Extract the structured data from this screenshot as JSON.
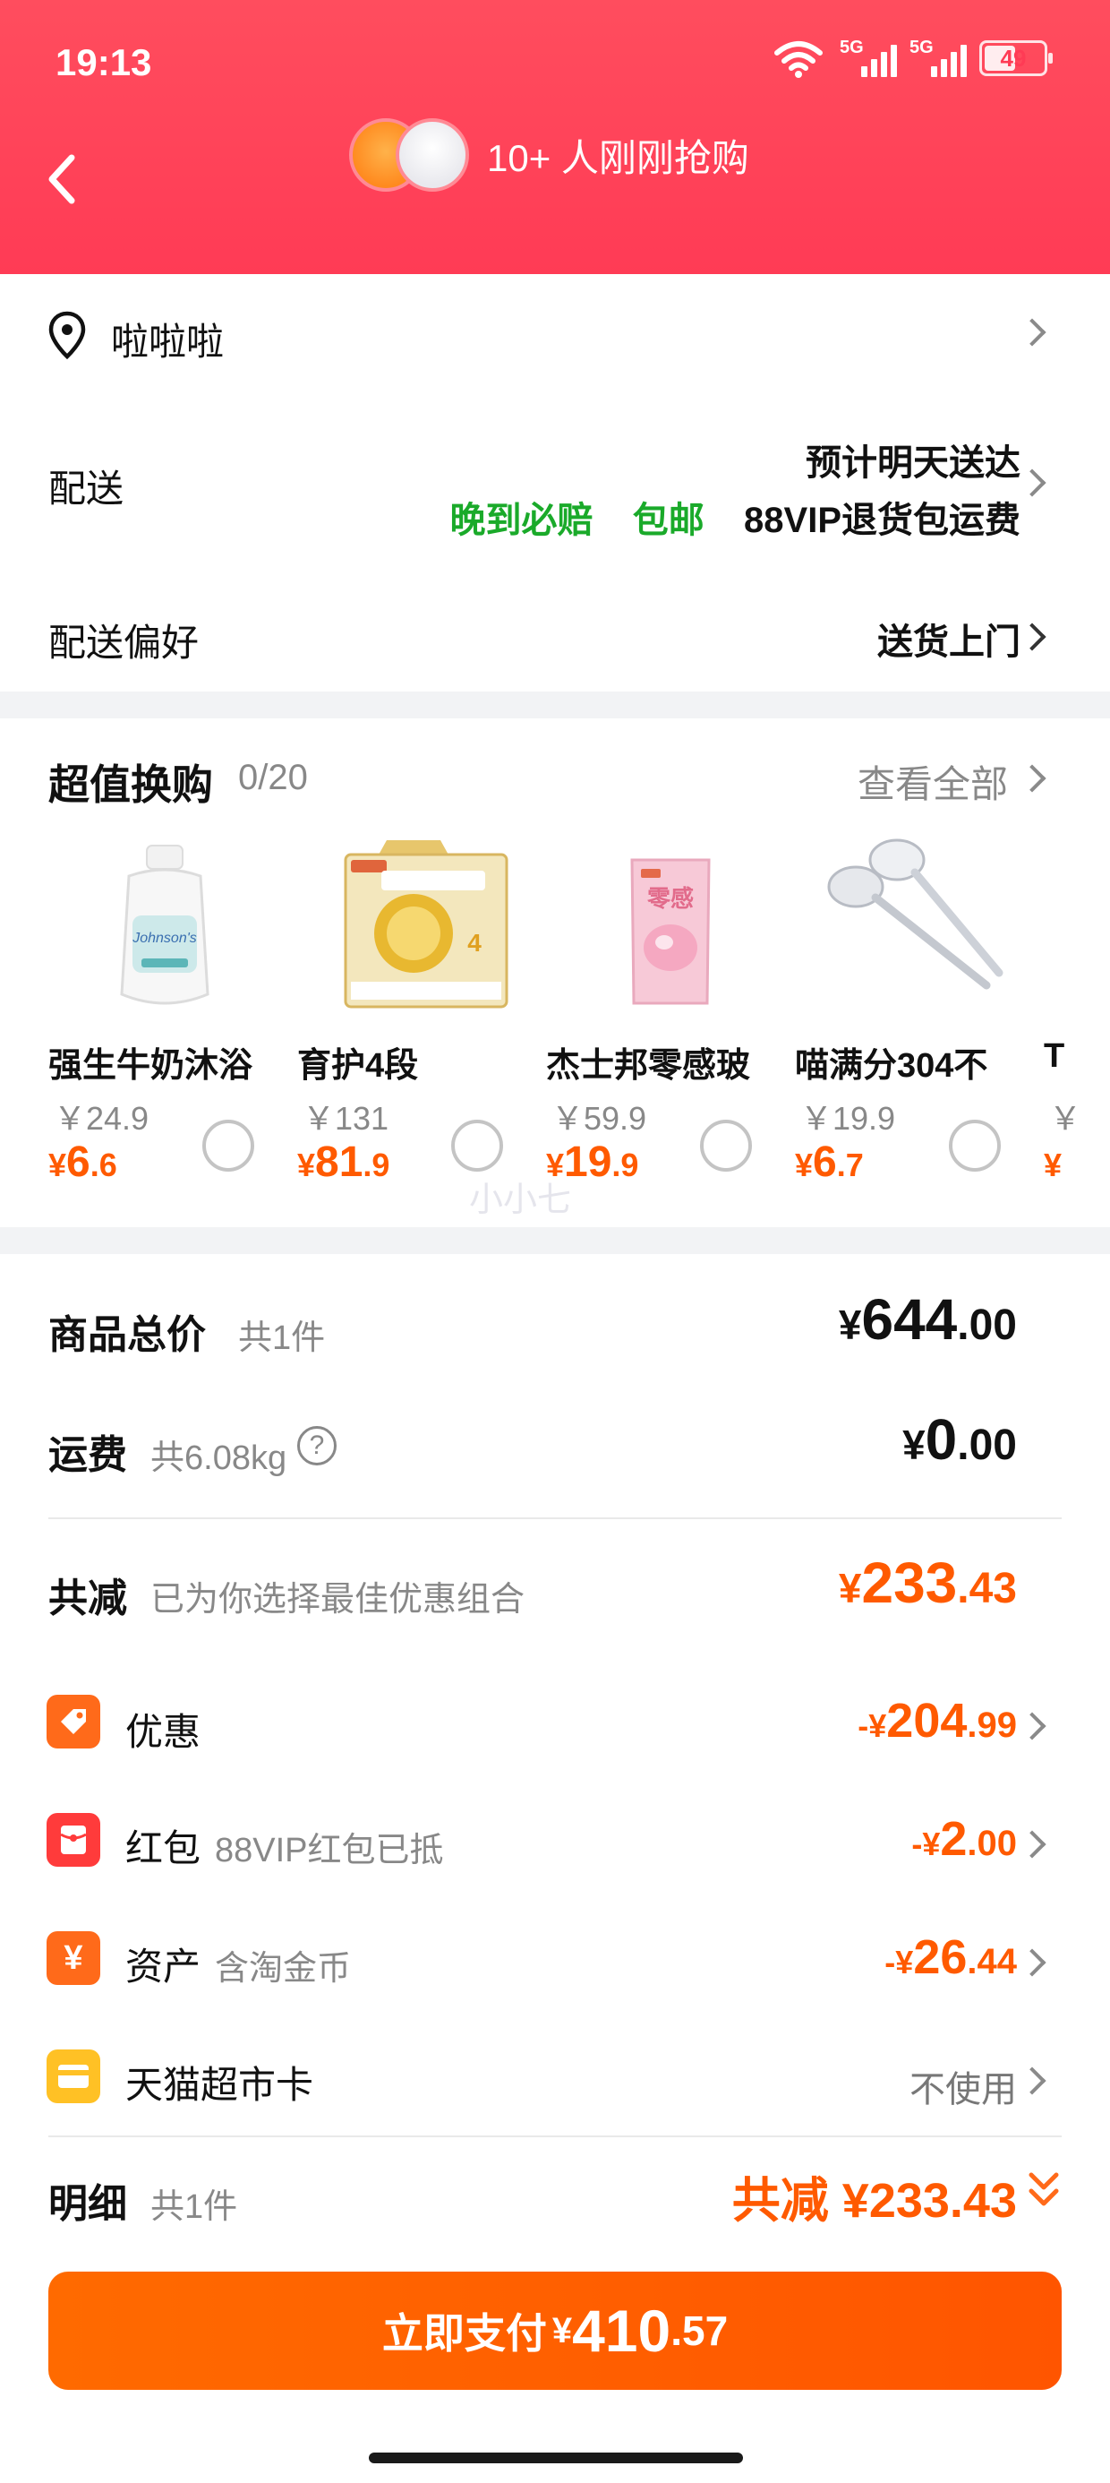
{
  "status_bar": {
    "time": "19:13",
    "net1": "5G",
    "net2": "5G",
    "battery": "49"
  },
  "header": {
    "buyers_text": "10+ 人刚刚抢购"
  },
  "address": {
    "text": "啦啦啦"
  },
  "delivery": {
    "label": "配送",
    "eta": "预计明天送达",
    "tag_late": "晚到必赔",
    "tag_free": "包邮",
    "tag_vip": "88VIP退货包运费"
  },
  "preference": {
    "label": "配送偏好",
    "value": "送货上门"
  },
  "swap": {
    "title": "超值换购",
    "count": "0/20",
    "view_all": "查看全部",
    "products": [
      {
        "name": "强生牛奶沐浴",
        "orig": "￥24.9",
        "yen": "¥",
        "int": "6",
        "dec": ".6"
      },
      {
        "name": "育护4段",
        "orig": "￥131",
        "yen": "¥",
        "int": "81",
        "dec": ".9"
      },
      {
        "name": "杰士邦零感玻",
        "orig": "￥59.9",
        "yen": "¥",
        "int": "19",
        "dec": ".9"
      },
      {
        "name": "喵满分304不",
        "orig": "￥19.9",
        "yen": "¥",
        "int": "6",
        "dec": ".7"
      },
      {
        "name": "T",
        "orig": "￥",
        "yen": "¥",
        "int": "",
        "dec": ""
      }
    ],
    "watermark": "小小七"
  },
  "totals": {
    "goods_label": "商品总价",
    "goods_sub": "共1件",
    "goods_yen": "¥",
    "goods_int": "644",
    "goods_dec": ".00",
    "ship_label": "运费",
    "ship_sub": "共6.08kg",
    "ship_help": "?",
    "ship_yen": "¥",
    "ship_int": "0",
    "ship_dec": ".00",
    "save_label": "共减",
    "save_sub": "已为你选择最佳优惠组合",
    "save_yen": "¥",
    "save_int": "233",
    "save_dec": ".43"
  },
  "discounts": [
    {
      "label": "优惠",
      "sub": "",
      "sign": "-¥",
      "int": "204",
      "dec": ".99",
      "color": "#ff6a1a"
    },
    {
      "label": "红包",
      "sub": "88VIP红包已抵",
      "sign": "-¥",
      "int": "2",
      "dec": ".00",
      "color": "#ff3b3b"
    },
    {
      "label": "资产",
      "sub": "含淘金币",
      "sign": "-¥",
      "int": "26",
      "dec": ".44",
      "color": "#ff6a1a"
    },
    {
      "label": "天猫超市卡",
      "sub": "",
      "value": "不使用",
      "color": "#ffc125"
    }
  ],
  "detail": {
    "label": "明细",
    "sub": "共1件",
    "amount": "共减 ¥233.43"
  },
  "pay": {
    "label": "立即支付",
    "yen": "¥",
    "int": "410",
    "dec": ".57"
  }
}
